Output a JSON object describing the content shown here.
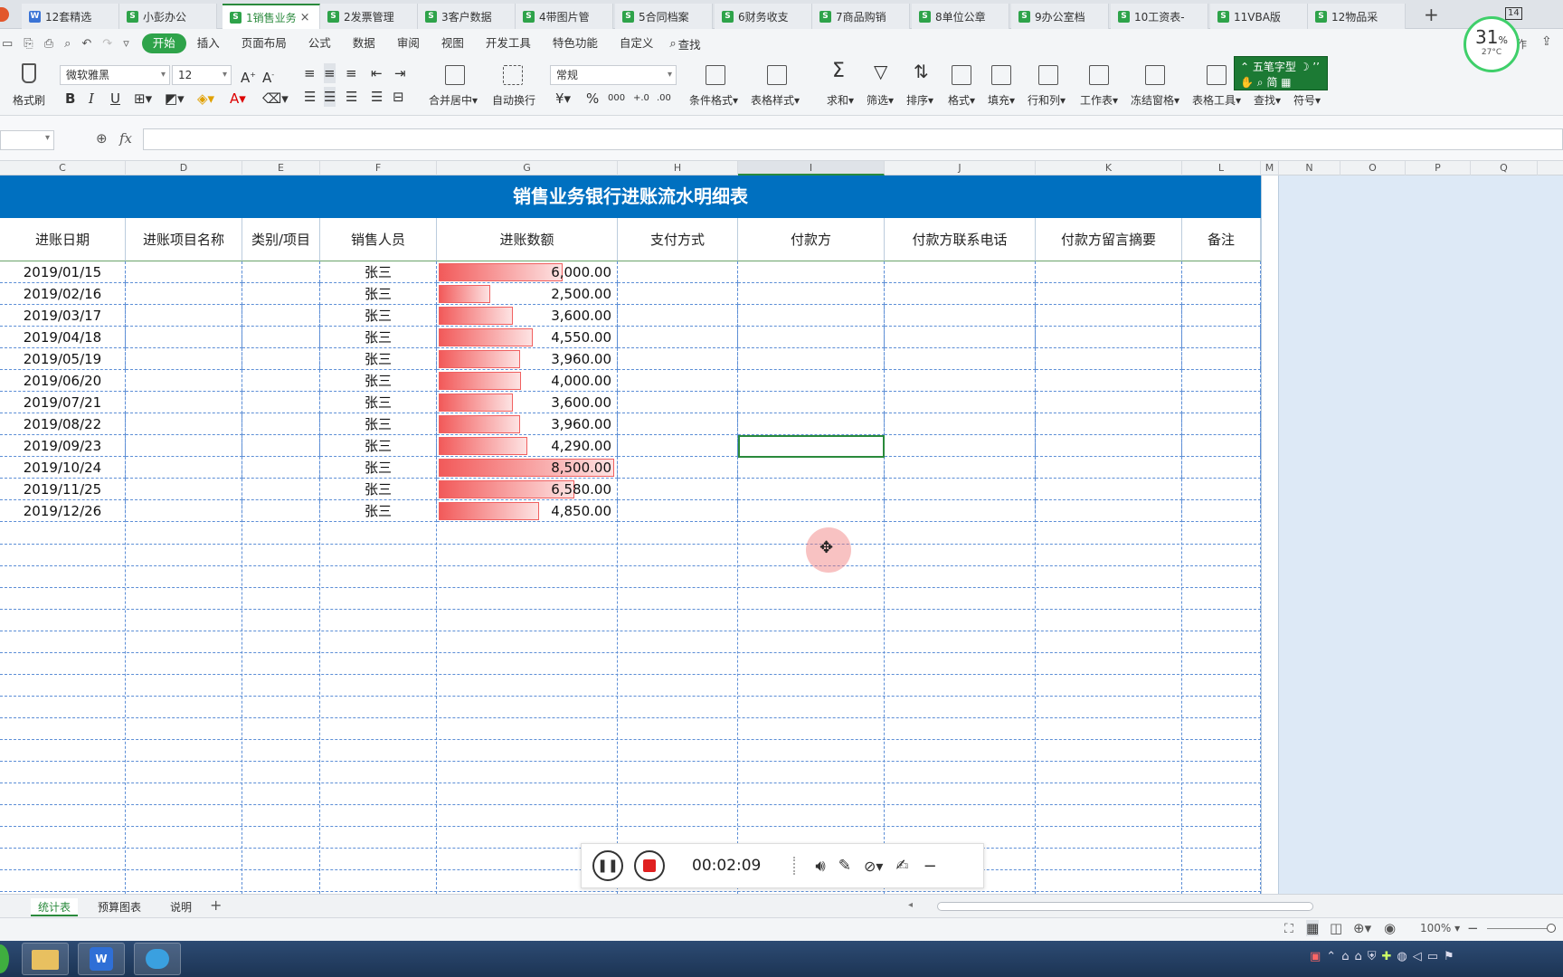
{
  "doc_tabs": [
    {
      "label": "12套精选",
      "icon": "W"
    },
    {
      "label": "小彭办公",
      "icon": "S"
    },
    {
      "label": "1销售业务",
      "icon": "S",
      "active": true
    },
    {
      "label": "2发票管理",
      "icon": "S"
    },
    {
      "label": "3客户数据",
      "icon": "S"
    },
    {
      "label": "4带图片管",
      "icon": "S"
    },
    {
      "label": "5合同档案",
      "icon": "S"
    },
    {
      "label": "6财务收支",
      "icon": "S"
    },
    {
      "label": "7商品购销",
      "icon": "S"
    },
    {
      "label": "8单位公章",
      "icon": "S"
    },
    {
      "label": "9办公室档",
      "icon": "S"
    },
    {
      "label": "10工资表-",
      "icon": "S"
    },
    {
      "label": "11VBA版",
      "icon": "S"
    },
    {
      "label": "12物品采",
      "icon": "S"
    }
  ],
  "tab_badge": "14",
  "cpu_widget": {
    "percent": "31",
    "unit": "%",
    "temp": "27°C"
  },
  "menu": [
    "开始",
    "插入",
    "页面布局",
    "公式",
    "数据",
    "审阅",
    "视图",
    "开发工具",
    "特色功能",
    "自定义"
  ],
  "search_label": "查找",
  "collab_label": "作",
  "ribbon": {
    "format_painter": "格式刷",
    "font_name": "微软雅黑",
    "font_size": "12",
    "number_format": "常规",
    "merge_center": "合并居中",
    "auto_wrap": "自动换行",
    "cond_format": "条件格式",
    "table_style": "表格样式",
    "sum": "求和",
    "filter": "筛选",
    "sort": "排序",
    "format": "格式",
    "fill": "填充",
    "row_col": "行和列",
    "worksheet": "工作表",
    "freeze": "冻结窗格",
    "table_tools": "表格工具",
    "find": "查找",
    "symbol": "符号",
    "currency": "¥",
    "percent": "%",
    "thousands": "000",
    "inc_dec": "+.0",
    "dec_dec": ".00"
  },
  "ime": {
    "name": "五笔字型",
    "mode": "简"
  },
  "formula": {
    "fx": "fx",
    "value": ""
  },
  "columns": [
    "C",
    "D",
    "E",
    "F",
    "G",
    "H",
    "I",
    "J",
    "K",
    "L",
    "M",
    "N",
    "O",
    "P",
    "Q"
  ],
  "sheet_title": "销售业务银行进账流水明细表",
  "headers": [
    "进账日期",
    "进账项目名称",
    "类别/项目",
    "销售人员",
    "进账数额",
    "支付方式",
    "付款方",
    "付款方联系电话",
    "付款方留言摘要",
    "备注"
  ],
  "rows": [
    {
      "date": "2019/01/15",
      "person": "张三",
      "amount": "6,000.00",
      "value": 6000
    },
    {
      "date": "2019/02/16",
      "person": "张三",
      "amount": "2,500.00",
      "value": 2500
    },
    {
      "date": "2019/03/17",
      "person": "张三",
      "amount": "3,600.00",
      "value": 3600
    },
    {
      "date": "2019/04/18",
      "person": "张三",
      "amount": "4,550.00",
      "value": 4550
    },
    {
      "date": "2019/05/19",
      "person": "张三",
      "amount": "3,960.00",
      "value": 3960
    },
    {
      "date": "2019/06/20",
      "person": "张三",
      "amount": "4,000.00",
      "value": 4000
    },
    {
      "date": "2019/07/21",
      "person": "张三",
      "amount": "3,600.00",
      "value": 3600
    },
    {
      "date": "2019/08/22",
      "person": "张三",
      "amount": "3,960.00",
      "value": 3960
    },
    {
      "date": "2019/09/23",
      "person": "张三",
      "amount": "4,290.00",
      "value": 4290
    },
    {
      "date": "2019/10/24",
      "person": "张三",
      "amount": "8,500.00",
      "value": 8500
    },
    {
      "date": "2019/11/25",
      "person": "张三",
      "amount": "6,580.00",
      "value": 6580
    },
    {
      "date": "2019/12/26",
      "person": "张三",
      "amount": "4,850.00",
      "value": 4850
    }
  ],
  "sheets": [
    "统计表",
    "预算图表",
    "说明"
  ],
  "recorder": {
    "time": "00:02:09"
  },
  "zoom": "100%",
  "colors": {
    "accent": "#2ea34a",
    "title_bg": "#0070c0",
    "bar": "#f25a5a"
  }
}
